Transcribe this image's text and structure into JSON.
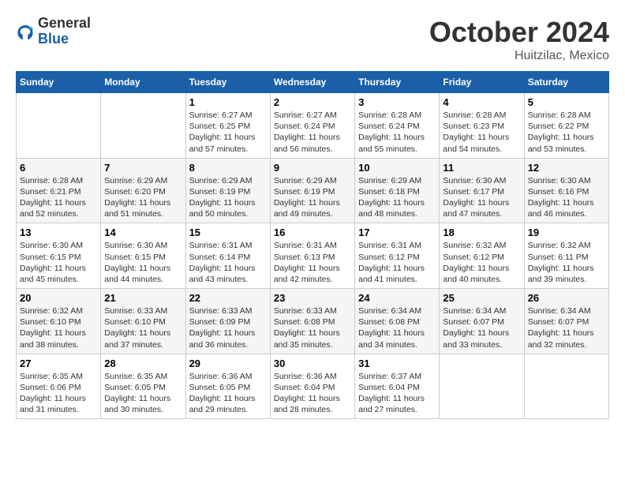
{
  "header": {
    "logo_general": "General",
    "logo_blue": "Blue",
    "month": "October 2024",
    "location": "Huitzilac, Mexico"
  },
  "weekdays": [
    "Sunday",
    "Monday",
    "Tuesday",
    "Wednesday",
    "Thursday",
    "Friday",
    "Saturday"
  ],
  "weeks": [
    [
      null,
      null,
      {
        "day": 1,
        "sunrise": "6:27 AM",
        "sunset": "6:25 PM",
        "daylight": "11 hours and 57 minutes."
      },
      {
        "day": 2,
        "sunrise": "6:27 AM",
        "sunset": "6:24 PM",
        "daylight": "11 hours and 56 minutes."
      },
      {
        "day": 3,
        "sunrise": "6:28 AM",
        "sunset": "6:24 PM",
        "daylight": "11 hours and 55 minutes."
      },
      {
        "day": 4,
        "sunrise": "6:28 AM",
        "sunset": "6:23 PM",
        "daylight": "11 hours and 54 minutes."
      },
      {
        "day": 5,
        "sunrise": "6:28 AM",
        "sunset": "6:22 PM",
        "daylight": "11 hours and 53 minutes."
      }
    ],
    [
      {
        "day": 6,
        "sunrise": "6:28 AM",
        "sunset": "6:21 PM",
        "daylight": "11 hours and 52 minutes."
      },
      {
        "day": 7,
        "sunrise": "6:29 AM",
        "sunset": "6:20 PM",
        "daylight": "11 hours and 51 minutes."
      },
      {
        "day": 8,
        "sunrise": "6:29 AM",
        "sunset": "6:19 PM",
        "daylight": "11 hours and 50 minutes."
      },
      {
        "day": 9,
        "sunrise": "6:29 AM",
        "sunset": "6:19 PM",
        "daylight": "11 hours and 49 minutes."
      },
      {
        "day": 10,
        "sunrise": "6:29 AM",
        "sunset": "6:18 PM",
        "daylight": "11 hours and 48 minutes."
      },
      {
        "day": 11,
        "sunrise": "6:30 AM",
        "sunset": "6:17 PM",
        "daylight": "11 hours and 47 minutes."
      },
      {
        "day": 12,
        "sunrise": "6:30 AM",
        "sunset": "6:16 PM",
        "daylight": "11 hours and 46 minutes."
      }
    ],
    [
      {
        "day": 13,
        "sunrise": "6:30 AM",
        "sunset": "6:15 PM",
        "daylight": "11 hours and 45 minutes."
      },
      {
        "day": 14,
        "sunrise": "6:30 AM",
        "sunset": "6:15 PM",
        "daylight": "11 hours and 44 minutes."
      },
      {
        "day": 15,
        "sunrise": "6:31 AM",
        "sunset": "6:14 PM",
        "daylight": "11 hours and 43 minutes."
      },
      {
        "day": 16,
        "sunrise": "6:31 AM",
        "sunset": "6:13 PM",
        "daylight": "11 hours and 42 minutes."
      },
      {
        "day": 17,
        "sunrise": "6:31 AM",
        "sunset": "6:12 PM",
        "daylight": "11 hours and 41 minutes."
      },
      {
        "day": 18,
        "sunrise": "6:32 AM",
        "sunset": "6:12 PM",
        "daylight": "11 hours and 40 minutes."
      },
      {
        "day": 19,
        "sunrise": "6:32 AM",
        "sunset": "6:11 PM",
        "daylight": "11 hours and 39 minutes."
      }
    ],
    [
      {
        "day": 20,
        "sunrise": "6:32 AM",
        "sunset": "6:10 PM",
        "daylight": "11 hours and 38 minutes."
      },
      {
        "day": 21,
        "sunrise": "6:33 AM",
        "sunset": "6:10 PM",
        "daylight": "11 hours and 37 minutes."
      },
      {
        "day": 22,
        "sunrise": "6:33 AM",
        "sunset": "6:09 PM",
        "daylight": "11 hours and 36 minutes."
      },
      {
        "day": 23,
        "sunrise": "6:33 AM",
        "sunset": "6:08 PM",
        "daylight": "11 hours and 35 minutes."
      },
      {
        "day": 24,
        "sunrise": "6:34 AM",
        "sunset": "6:08 PM",
        "daylight": "11 hours and 34 minutes."
      },
      {
        "day": 25,
        "sunrise": "6:34 AM",
        "sunset": "6:07 PM",
        "daylight": "11 hours and 33 minutes."
      },
      {
        "day": 26,
        "sunrise": "6:34 AM",
        "sunset": "6:07 PM",
        "daylight": "11 hours and 32 minutes."
      }
    ],
    [
      {
        "day": 27,
        "sunrise": "6:35 AM",
        "sunset": "6:06 PM",
        "daylight": "11 hours and 31 minutes."
      },
      {
        "day": 28,
        "sunrise": "6:35 AM",
        "sunset": "6:05 PM",
        "daylight": "11 hours and 30 minutes."
      },
      {
        "day": 29,
        "sunrise": "6:36 AM",
        "sunset": "6:05 PM",
        "daylight": "11 hours and 29 minutes."
      },
      {
        "day": 30,
        "sunrise": "6:36 AM",
        "sunset": "6:04 PM",
        "daylight": "11 hours and 28 minutes."
      },
      {
        "day": 31,
        "sunrise": "6:37 AM",
        "sunset": "6:04 PM",
        "daylight": "11 hours and 27 minutes."
      },
      null,
      null
    ]
  ]
}
